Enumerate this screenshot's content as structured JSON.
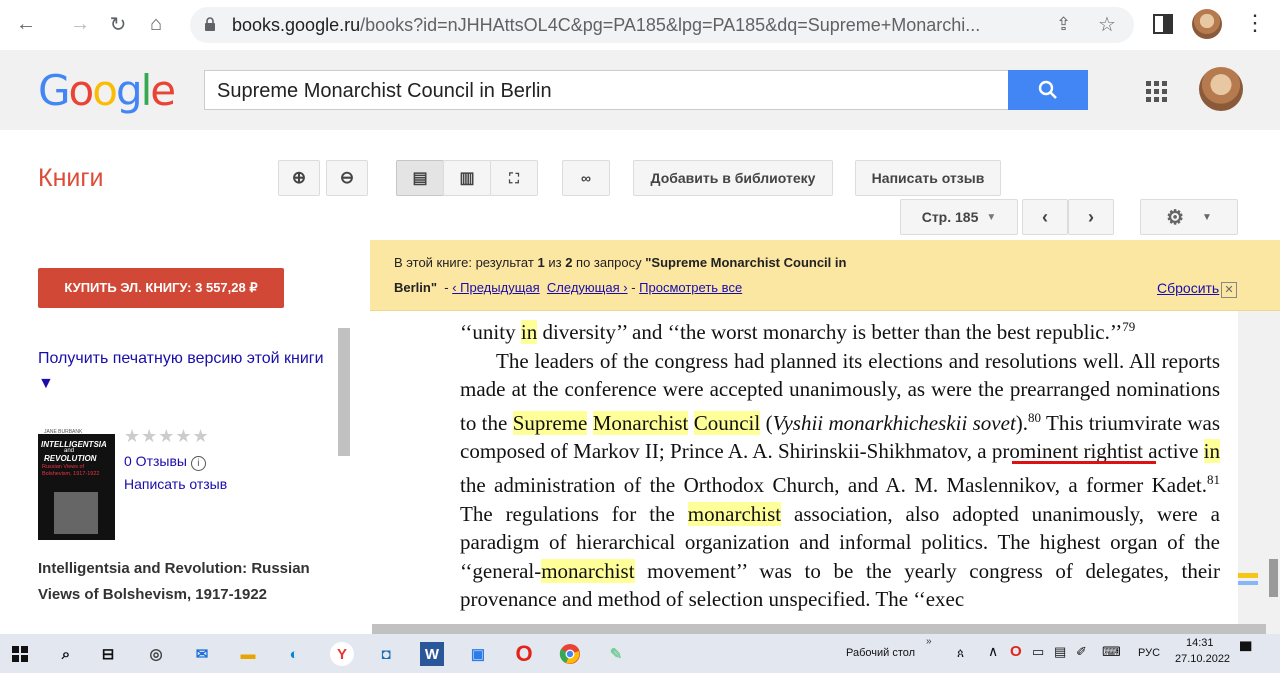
{
  "browser": {
    "url_domain": "books.google.ru",
    "url_path": "/books?id=nJHHAttsOL4C&pg=PA185&lpg=PA185&dq=Supreme+Monarchi..."
  },
  "google": {
    "logo": "Google",
    "search_query": "Supreme Monarchist Council in Berlin"
  },
  "books": {
    "title": "Книги",
    "add_to_library": "Добавить в библиотеку",
    "write_review": "Написать отзыв",
    "page_label": "Стр. 185"
  },
  "sidebar": {
    "buy_button": "КУПИТЬ ЭЛ. КНИГУ: 3 557,28 ₽",
    "print_version": "Получить печатную версию этой книги ▼",
    "rating_stars": "★★★★★",
    "reviews_count": "0 Отзывы",
    "write_review": "Написать отзыв",
    "book_title": "Intelligentsia and Revolution: Russian Views of Bolshevism, 1917-1922",
    "cover": {
      "publisher": "JANE BURBANK",
      "title_line1": "INTELLIGENTSIA",
      "title_line2": "and",
      "title_line3": "REVOLUTION",
      "subtitle": "Russian Views of Bolshevism, 1917-1922"
    }
  },
  "banner": {
    "prefix": "В этой книге: результат",
    "result_num": "1",
    "of_word": "из",
    "total": "2",
    "query_prefix": "по запросу",
    "query_quoted": "\"Supreme Monarchist Council in",
    "query_end": "Berlin\"",
    "sep1": "-",
    "prev_link": "‹ Предыдущая",
    "next_link": "Следующая ›",
    "sep2": "-",
    "view_all": "Просмотреть все",
    "reset": "Сбросить",
    "close": "✕"
  },
  "page_text": {
    "l1a": "‘‘unity ",
    "l1b": "in",
    "l1c": " diversity’’ and ‘‘the worst monarchy is better than the best republic.’’",
    "fn79": "79",
    "l2": "The leaders of the congress had planned its elections and resolutions well. All reports made at the conference were accepted unanimously, as were the prearranged nominations to the ",
    "h_supreme": "Supreme",
    "h_monarchist": "Monarchist",
    "h_council": "Council",
    "l3": " (",
    "l3i": "Vyshii monarkhicheskii sovet",
    "l3b": ").",
    "fn80": "80",
    "l4": " This triumvirate was composed of Markov II; Prince A. A. Shirinskii-Shikhmatov, a prominent rightist active ",
    "h_in2": "in",
    "l5": " the administration of the Orthodox Church, and A. M. Maslennikov, a former Kadet.",
    "fn81": "81",
    "l6": " The regulations for the ",
    "h_mon2": "monarchist",
    "l7": " association, also adopted unanimously, were a paradigm of hierarchical organization and informal politics. The highest organ of the ‘‘general-",
    "h_mon3": "monarchist",
    "l8": " movement’’ was to be the yearly congress of delegates, their provenance and method of selection unspecified. The ‘‘exec"
  },
  "taskbar": {
    "desktop_label": "Рабочий стол",
    "lang": "РУС",
    "time": "14:31",
    "date": "27.10.2022"
  },
  "colors": {
    "buy_red": "#d14836",
    "books_red": "#dd4b39",
    "search_blue": "#4285f4",
    "banner_yellow": "#fbe6a2",
    "highlight": "#ffff99"
  }
}
